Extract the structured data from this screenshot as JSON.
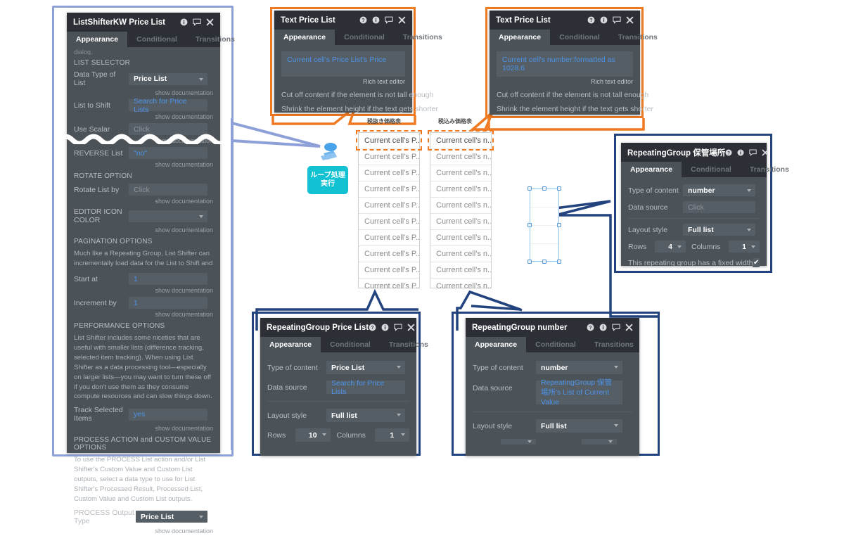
{
  "colors": {
    "panel_bg": "#4b5258",
    "panel_head": "#2c3036",
    "accent_orange": "#f07a22",
    "accent_navy": "#22437e",
    "accent_periwinkle": "#8ea0d8",
    "accent_teal": "#12c2d3",
    "link_blue": "#4c93e8",
    "selection_blue": "#8dc3f0"
  },
  "tabs": {
    "appearance": "Appearance",
    "conditional": "Conditional",
    "transitions": "Transitions"
  },
  "icons": {
    "help": "help-icon",
    "info": "info-icon",
    "comment": "comment-icon",
    "close": "close-icon",
    "dropdown": "chevron-down-icon",
    "check": "✔"
  },
  "common": {
    "show_documentation": "show documentation",
    "click_placeholder": "Click",
    "rich_text_editor": "Rich text editor"
  },
  "list_shifter": {
    "title": "ListShifterKW Price List",
    "clipped_text": "dialog.",
    "section_list_selector": "LIST SELECTOR",
    "fields": [
      {
        "label": "Data Type of List",
        "value": "Price List",
        "kind": "dropdown"
      },
      {
        "label": "List to Shift",
        "value": "Search for Price Lists",
        "kind": "link"
      },
      {
        "label": "Use Scalar",
        "value": "Click",
        "kind": "placeholder"
      },
      {
        "label": "REVERSE List",
        "value": "\"no\"",
        "kind": "blue"
      }
    ],
    "section_rotate": "ROTATE OPTION",
    "rotate_field": {
      "label": "Rotate List by",
      "value": "Click",
      "kind": "placeholder"
    },
    "editor_icon_color_label": "EDITOR ICON COLOR",
    "section_pagination": "PAGINATION OPTIONS",
    "pagination_text": "Much like a Repeating Group, List Shifter can incrementally load data for the List to Shift and",
    "start_at": {
      "label": "Start at",
      "value": "1"
    },
    "increment_by": {
      "label": "Increment by",
      "value": "1"
    },
    "section_performance": "PERFORMANCE OPTIONS",
    "performance_text": "List Shifter includes some niceties that are useful with smaller lists (difference tracking, selected item tracking). When using List Shifter as a data processing tool—especially on larger lists—you may want to turn these off if you don't use them as they consume compute resources and can slow things down.",
    "track_selected": {
      "label": "Track Selected Items",
      "value": "yes"
    },
    "section_process": "PROCESS ACTION and CUSTOM VALUE OPTIONS",
    "process_text": "To use the PROCESS List action and/or List Shifter's Custom Value and Custom List outputs, select a data type to use for List Shifter's Processed Result, Processed List, Custom Value and Custom List outputs.",
    "process_output": {
      "label": "PROCESS Output Type",
      "value": "Price List"
    }
  },
  "text_price_list_1": {
    "title": "Text Price List",
    "content": "Current cell's Price List's Price",
    "editor_note": "Rich text editor",
    "option_cut_off": "Cut off content if the element is not tall enough",
    "option_shrink": "Shrink the element height if the text gets shorter"
  },
  "text_price_list_2": {
    "title": "Text Price List",
    "content": "Current cell's number:formatted as 1028.6",
    "editor_note": "Rich text editor",
    "option_cut_off": "Cut off content if the element is not tall enough",
    "option_shrink": "Shrink the element height if the text gets shorter"
  },
  "rg_hokanbasho": {
    "title": "RepeatingGroup 保管場所",
    "type_of_content": {
      "label": "Type of content",
      "value": "number"
    },
    "data_source": {
      "label": "Data source",
      "value": "Click"
    },
    "layout_style": {
      "label": "Layout style",
      "value": "Full list"
    },
    "rows": {
      "label": "Rows",
      "value": "4"
    },
    "columns": {
      "label": "Columns",
      "value": "1"
    },
    "fixed_width": {
      "label": "This repeating group has a fixed width",
      "checked": "✔"
    }
  },
  "rg_price_list": {
    "title": "RepeatingGroup Price List",
    "type_of_content": {
      "label": "Type of content",
      "value": "Price List"
    },
    "data_source": {
      "label": "Data source",
      "value": "Search for Price Lists"
    },
    "layout_style": {
      "label": "Layout style",
      "value": "Full list"
    },
    "rows": {
      "label": "Rows",
      "value": "10"
    },
    "columns": {
      "label": "Columns",
      "value": "1"
    }
  },
  "rg_number": {
    "title": "RepeatingGroup number",
    "type_of_content": {
      "label": "Type of content",
      "value": "number"
    },
    "data_source": {
      "label": "Data source",
      "value": "RepeatingGroup 保管場所's List of Current Value"
    },
    "layout_style": {
      "label": "Layout style",
      "value": "Full list"
    }
  },
  "canvas": {
    "col1_label": "税抜き価格表",
    "col2_label": "税込み価格表",
    "col1_cell": "Current cell's P...",
    "col2_cell": "Current cell's n...",
    "row_count": 10,
    "loop_button": "ループ処理\n実行",
    "loop_button_line1": "ループ処理",
    "loop_button_line2": "実行"
  }
}
